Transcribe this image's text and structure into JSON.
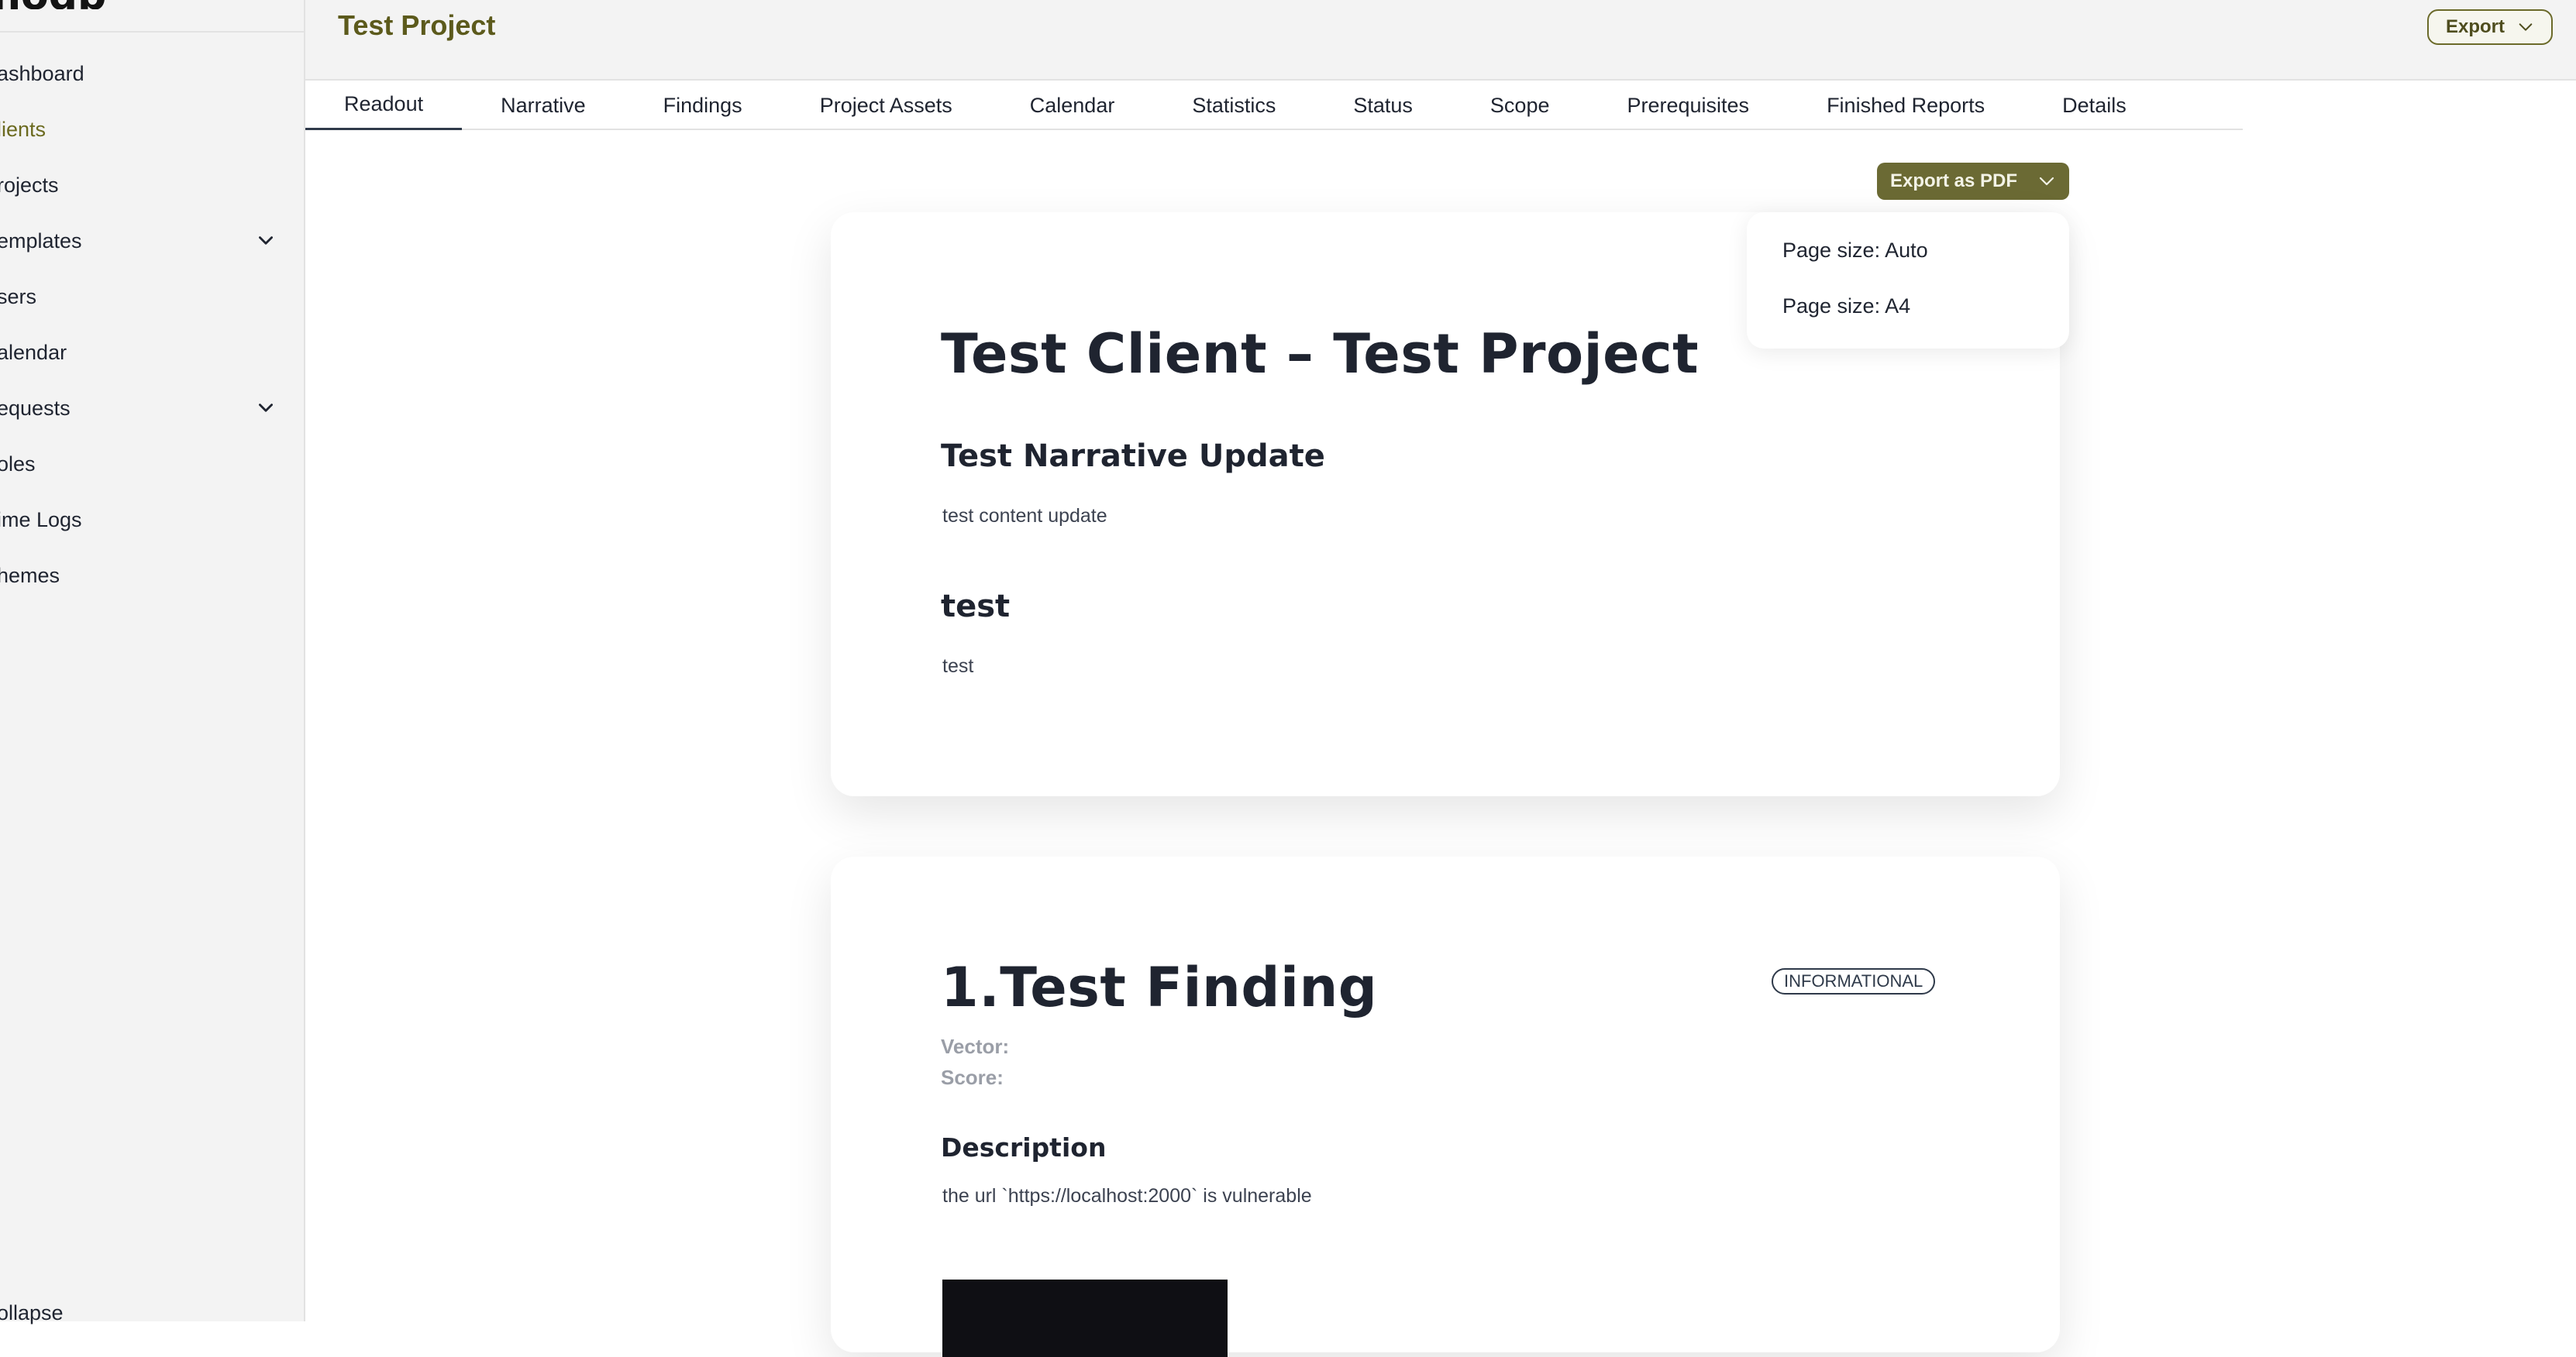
{
  "sidebar": {
    "logo": "nodb",
    "items": [
      {
        "label": "ashboard",
        "active": false,
        "expandable": false
      },
      {
        "label": "lients",
        "active": true,
        "expandable": false
      },
      {
        "label": "rojects",
        "active": false,
        "expandable": false
      },
      {
        "label": "emplates",
        "active": false,
        "expandable": true
      },
      {
        "label": "sers",
        "active": false,
        "expandable": false
      },
      {
        "label": "alendar",
        "active": false,
        "expandable": false
      },
      {
        "label": "equests",
        "active": false,
        "expandable": true
      },
      {
        "label": "oles",
        "active": false,
        "expandable": false
      },
      {
        "label": "ime Logs",
        "active": false,
        "expandable": false
      },
      {
        "label": "hemes",
        "active": false,
        "expandable": false
      }
    ],
    "collapse_label": "ollapse"
  },
  "header": {
    "title": "Test Project",
    "export_label": "Export"
  },
  "tabs": [
    {
      "label": "Readout",
      "active": true
    },
    {
      "label": "Narrative",
      "active": false
    },
    {
      "label": "Findings",
      "active": false
    },
    {
      "label": "Project Assets",
      "active": false
    },
    {
      "label": "Calendar",
      "active": false
    },
    {
      "label": "Statistics",
      "active": false
    },
    {
      "label": "Status",
      "active": false
    },
    {
      "label": "Scope",
      "active": false
    },
    {
      "label": "Prerequisites",
      "active": false
    },
    {
      "label": "Finished Reports",
      "active": false
    },
    {
      "label": "Details",
      "active": false
    }
  ],
  "pdf_export": {
    "label": "Export as PDF",
    "options": [
      "Page size: Auto",
      "Page size: A4"
    ]
  },
  "report": {
    "title": "Test Client – Test Project",
    "sections": [
      {
        "heading": "Test Narrative Update",
        "content": "test content update"
      },
      {
        "heading": "test",
        "content": "test"
      }
    ]
  },
  "finding": {
    "title": "1.Test Finding",
    "severity": "INFORMATIONAL",
    "vector_label": "Vector:",
    "score_label": "Score:",
    "description_heading": "Description",
    "description": "the url `https://localhost:2000` is vulnerable"
  },
  "colors": {
    "accent": "#6b6a34",
    "accent_text": "#5c5a1c",
    "sidebar_bg": "#f3f3f3"
  }
}
